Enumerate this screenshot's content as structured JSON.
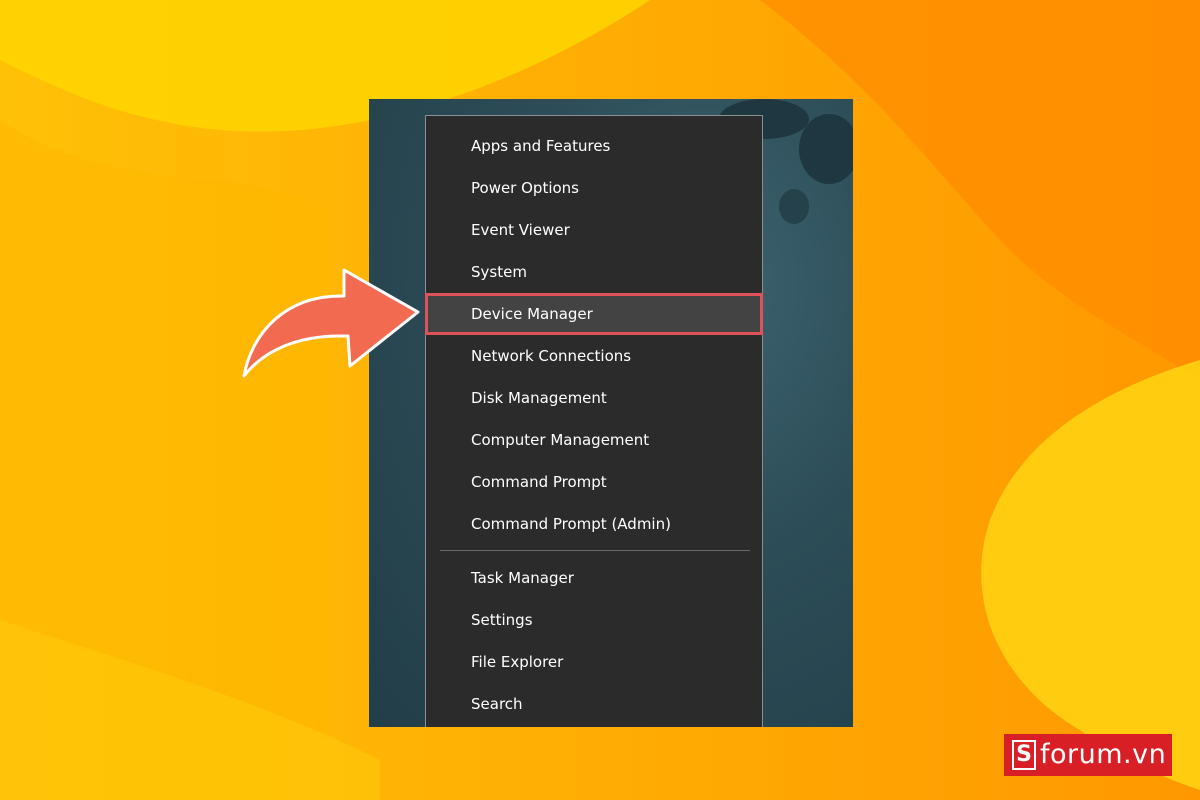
{
  "menu": {
    "group1": [
      "Apps and Features",
      "Power Options",
      "Event Viewer",
      "System",
      "Device Manager",
      "Network Connections",
      "Disk Management",
      "Computer Management",
      "Command Prompt",
      "Command Prompt (Admin)"
    ],
    "group2": [
      "Task Manager",
      "Settings",
      "File Explorer",
      "Search"
    ],
    "highlighted_item": "Device Manager"
  },
  "watermark": {
    "mark": "S",
    "text": "forum.vn"
  },
  "colors": {
    "background_primary": "#ffb300",
    "background_secondary": "#ff8f00",
    "menu_background": "#2b2b2b",
    "highlight_border": "#e0525a",
    "arrow_fill": "#f26a4f",
    "logo_red": "#d81f26"
  },
  "icons": {
    "pointer": "curved-arrow-icon"
  }
}
